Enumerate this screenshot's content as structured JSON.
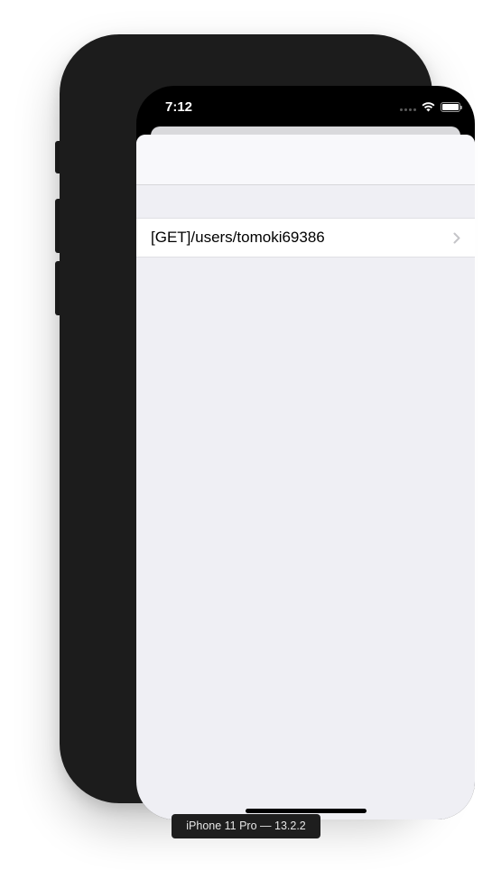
{
  "status_bar": {
    "time": "7:12",
    "icons": [
      "cellular-signal-icon",
      "wifi-icon",
      "battery-icon"
    ]
  },
  "table": {
    "rows": [
      {
        "label": "[GET]/users/tomoki69386",
        "accessory": "chevron-right-icon"
      }
    ]
  },
  "device_label": "iPhone 11 Pro — 13.2.2",
  "colors": {
    "frame": "#1c1c1c",
    "background": "#efeff4",
    "nav_bar": "#f8f8fb",
    "cell": "#ffffff",
    "text": "#000000",
    "chevron": "#c4c4c8"
  }
}
